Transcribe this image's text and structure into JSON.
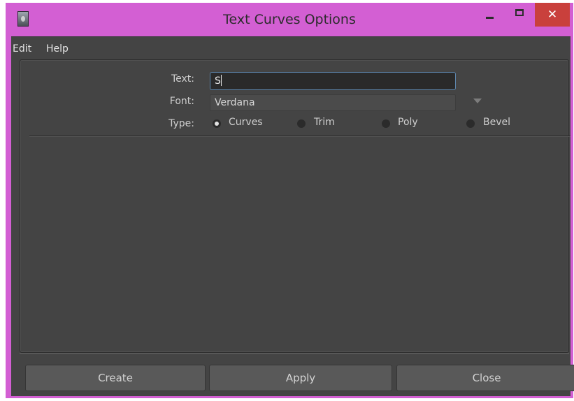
{
  "window": {
    "title": "Text Curves Options",
    "close_glyph": "✕"
  },
  "menu": {
    "items": [
      "Edit",
      "Help"
    ]
  },
  "form": {
    "text_label": "Text:",
    "text_value": "S",
    "font_label": "Font:",
    "font_value": "Verdana",
    "type_label": "Type:",
    "type_options": [
      "Curves",
      "Trim",
      "Poly",
      "Bevel"
    ],
    "type_selected": "Curves"
  },
  "buttons": {
    "create": "Create",
    "apply": "Apply",
    "close": "Close"
  },
  "colors": {
    "titlebar": "#d35fd3",
    "close_button": "#c9403c",
    "panel_background": "#444444",
    "focus_border": "#5d86ad"
  }
}
